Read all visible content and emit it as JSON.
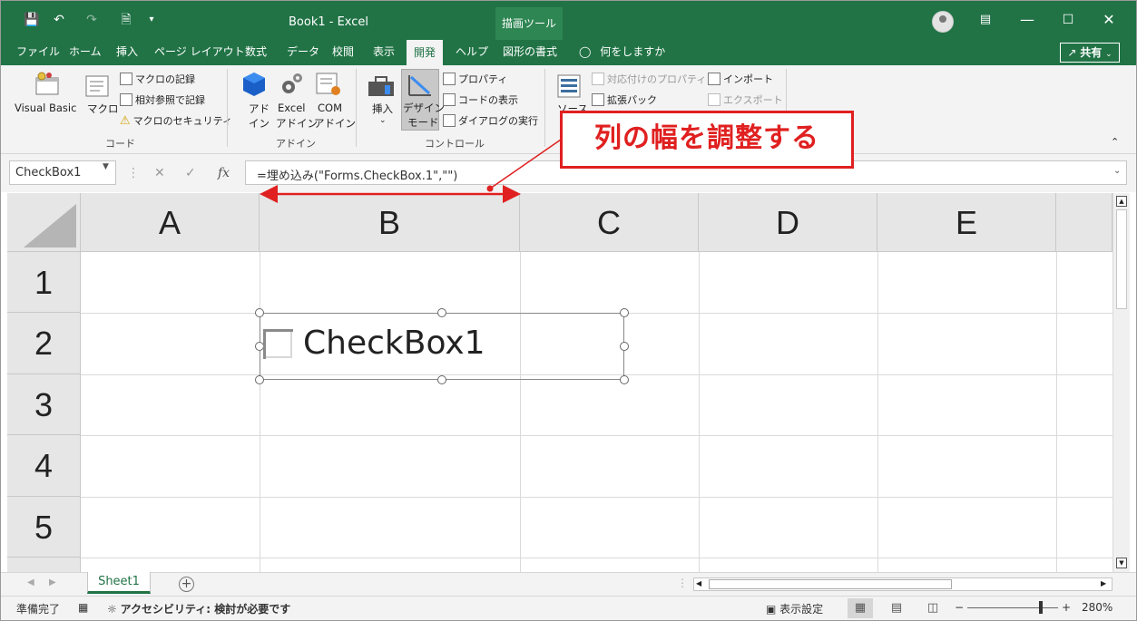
{
  "titlebar": {
    "doc_title": "Book1  -  Excel",
    "context_tab": "描画ツール"
  },
  "menu": {
    "tabs": [
      "ファイル",
      "ホーム",
      "挿入",
      "ページ レイアウト",
      "数式",
      "データ",
      "校閲",
      "表示",
      "開発",
      "ヘルプ",
      "図形の書式"
    ],
    "active_tab": "開発",
    "tell_me": "何をしますか",
    "share": "共有"
  },
  "ribbon": {
    "code": {
      "visual_basic": "Visual Basic",
      "macro": "マクロ",
      "record_macro": "マクロの記録",
      "relative_ref": "相対参照で記録",
      "macro_security": "マクロのセキュリティ",
      "label": "コード"
    },
    "addins": {
      "addin_1": "アド",
      "addin_2": "イン",
      "excel_1": "Excel",
      "excel_2": "アドイン",
      "com_1": "COM",
      "com_2": "アドイン",
      "label": "アドイン"
    },
    "controls": {
      "insert": "挿入",
      "design_mode_1": "デザイン",
      "design_mode_2": "モード",
      "properties": "プロパティ",
      "view_code": "コードの表示",
      "run_dialog": "ダイアログの実行",
      "label": "コントロール"
    },
    "xml": {
      "source_partial": "ソース",
      "map_properties": "対応付けのプロパティ",
      "expansion_pack": "拡張パック",
      "import": "インポート",
      "export": "エクスポート"
    }
  },
  "formula_bar": {
    "name_box": "CheckBox1",
    "cancel": "✕",
    "enter": "✓",
    "fx": "fx",
    "formula": "=埋め込み(\"Forms.CheckBox.1\",\"\")"
  },
  "grid": {
    "columns": [
      "A",
      "B",
      "C",
      "D",
      "E"
    ],
    "rows": [
      "1",
      "2",
      "3",
      "4",
      "5"
    ]
  },
  "checkbox_control": {
    "label": "CheckBox1"
  },
  "sheets": {
    "active": "Sheet1",
    "add": "+"
  },
  "statusbar": {
    "ready": "準備完了",
    "accessibility": "アクセシビリティ: 検討が必要です",
    "display_settings": "表示設定",
    "zoom": "280%",
    "zoom_minus": "−",
    "zoom_plus": "+"
  },
  "annotation": {
    "callout": "列の幅を調整する",
    "color": "#e02020"
  },
  "colors": {
    "excel_green": "#217346"
  }
}
